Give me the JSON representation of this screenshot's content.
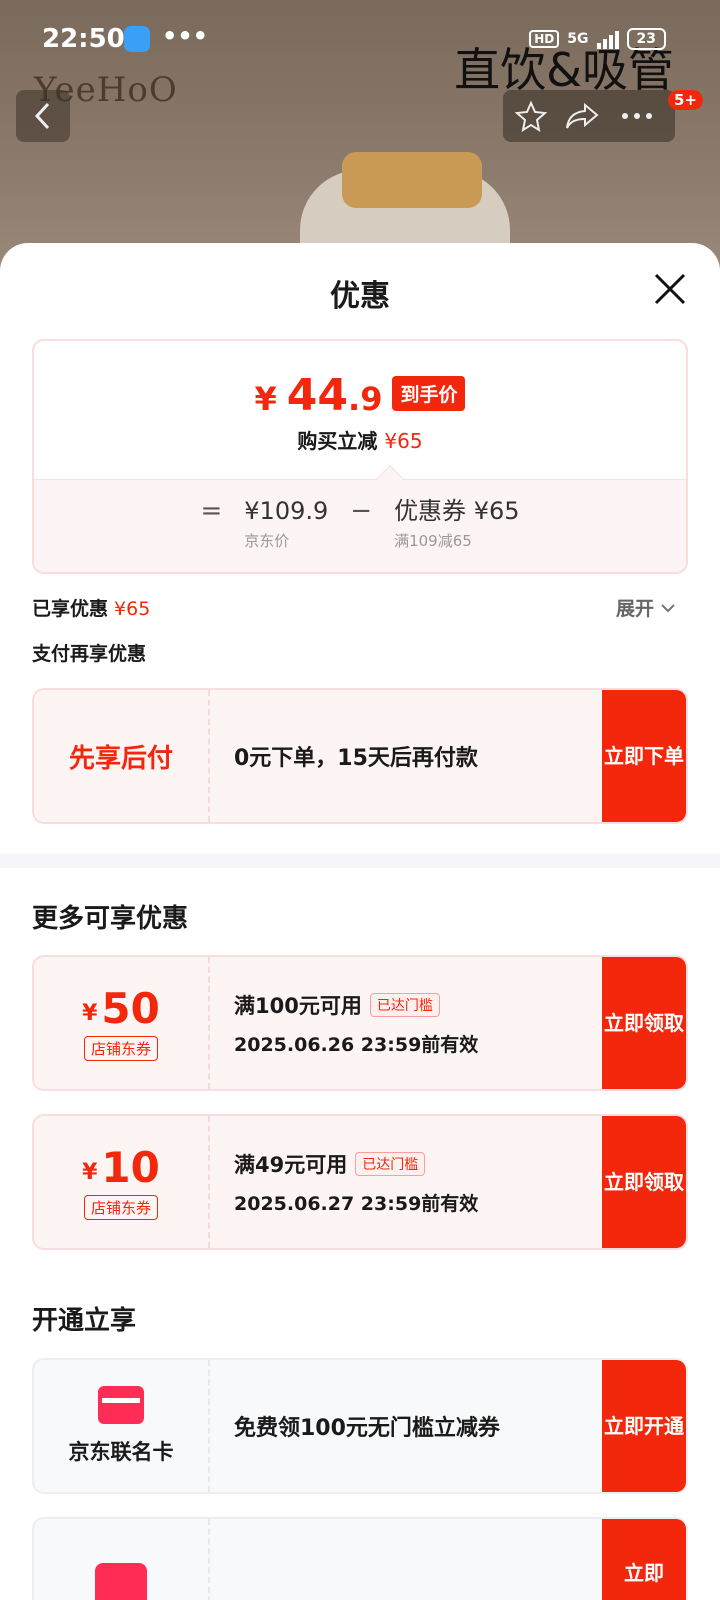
{
  "status_bar": {
    "time": "22:50",
    "dots": "•••",
    "hd": "HD",
    "network": "5G",
    "battery": "23"
  },
  "background": {
    "brand": "YeeHoO",
    "product_title": "直饮&吸管",
    "badge_count": "5+"
  },
  "sheet": {
    "title": "优惠"
  },
  "price_card": {
    "currency": "¥",
    "price_int": "44",
    "price_dec": ".9",
    "price_tag": "到手价",
    "reduce_label": "购买立减",
    "reduce_amount": "¥65",
    "equals": "=",
    "minus": "−",
    "jd_price": "¥109.9",
    "jd_price_label": "京东价",
    "coupon_value": "优惠券 ¥65",
    "coupon_rule": "满109减65"
  },
  "enjoyed": {
    "label": "已享优惠",
    "amount": "¥65",
    "expand_label": "展开"
  },
  "pay_more": {
    "label": "支付再享优惠"
  },
  "bnpl": {
    "title": "先享后付",
    "desc": "0元下单，15天后再付款",
    "cta": "立即下单"
  },
  "more_offers": {
    "title": "更多可享优惠",
    "coupons": [
      {
        "yen": "¥",
        "amount": "50",
        "tag": "店铺东券",
        "condition": "满100元可用",
        "reached": "已达门槛",
        "expiry": "2025.06.26 23:59前有效",
        "cta": "立即领取"
      },
      {
        "yen": "¥",
        "amount": "10",
        "tag": "店铺东券",
        "condition": "满49元可用",
        "reached": "已达门槛",
        "expiry": "2025.06.27 23:59前有效",
        "cta": "立即领取"
      }
    ]
  },
  "join": {
    "title": "开通立享",
    "card_name": "京东联名卡",
    "card_desc": "免费领100元无门槛立减券",
    "card_cta": "立即开通",
    "second_cta": "立即"
  },
  "colors": {
    "accent": "#f2270c"
  }
}
